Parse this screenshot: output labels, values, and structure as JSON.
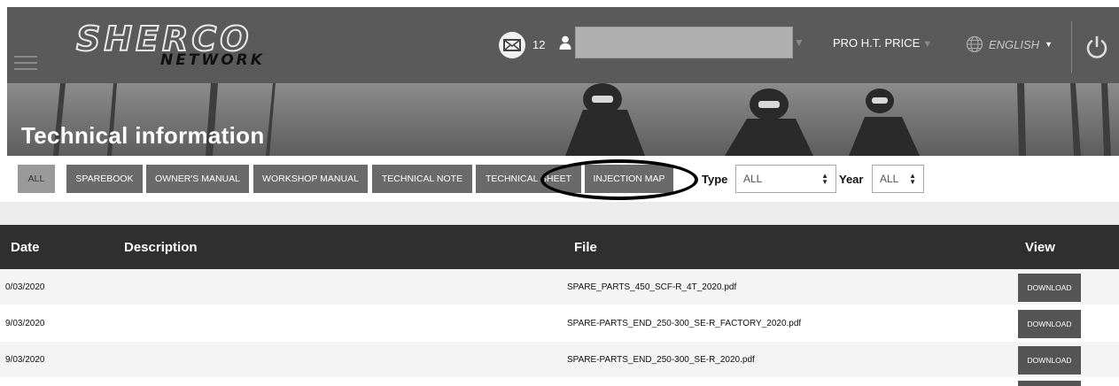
{
  "header": {
    "logo": {
      "line1": "SHERCO",
      "line2": "NETWORK"
    },
    "mail_count": "12",
    "user_name": "",
    "price_label": "PRO H.T. PRICE",
    "language": "ENGLISH"
  },
  "banner": {
    "title": "Technical information"
  },
  "filters": {
    "buttons": [
      "ALL",
      "SPAREBOOK",
      "OWNER'S MANUAL",
      "WORKSHOP MANUAL",
      "TECHNICAL NOTE",
      "TECHNICAL SHEET",
      "INJECTION MAP"
    ],
    "type_label": "Type",
    "type_value": "ALL",
    "year_label": "Year",
    "year_value": "ALL"
  },
  "table": {
    "columns": [
      "Date",
      "Description",
      "File",
      "View"
    ],
    "rows": [
      {
        "date": "0/03/2020",
        "description": "",
        "file": "SPARE_PARTS_450_SCF-R_4T_2020.pdf",
        "action": "DOWNLOAD"
      },
      {
        "date": "9/03/2020",
        "description": "",
        "file": "SPARE-PARTS_END_250-300_SE-R_FACTORY_2020.pdf",
        "action": "DOWNLOAD"
      },
      {
        "date": "9/03/2020",
        "description": "",
        "file": "SPARE-PARTS_END_250-300_SE-R_2020.pdf",
        "action": "DOWNLOAD"
      }
    ]
  },
  "icons": {
    "menu": "hamburger-icon",
    "mail": "mail-icon",
    "user": "user-icon",
    "language": "globe-icon",
    "logout": "power-icon"
  },
  "colors": {
    "header_bg": "#5a5a5a",
    "table_header_bg": "#2f2f2f",
    "button_bg": "#6a6a6a",
    "highlight_oval": "#000000"
  }
}
